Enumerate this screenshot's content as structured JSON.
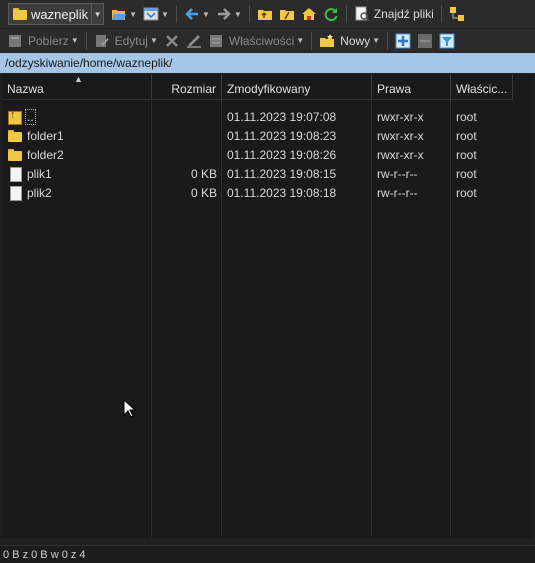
{
  "toolbar": {
    "session_label": "wazneplik",
    "find_files_label": "Znajdź pliki",
    "download_label": "Pobierz",
    "edit_label": "Edytuj",
    "properties_label": "Właściwości",
    "new_label": "Nowy"
  },
  "path": "/odzyskiwanie/home/wazneplik/",
  "columns": {
    "name": "Nazwa",
    "size": "Rozmiar",
    "modified": "Zmodyfikowany",
    "rights": "Prawa",
    "owner": "Właścic..."
  },
  "files": [
    {
      "name": "..",
      "size": "",
      "modified": "01.11.2023 19:07:08",
      "rights": "rwxr-xr-x",
      "owner": "root",
      "icon": "parent-folder-icon"
    },
    {
      "name": "folder1",
      "size": "",
      "modified": "01.11.2023 19:08:23",
      "rights": "rwxr-xr-x",
      "owner": "root",
      "icon": "folder-icon"
    },
    {
      "name": "folder2",
      "size": "",
      "modified": "01.11.2023 19:08:26",
      "rights": "rwxr-xr-x",
      "owner": "root",
      "icon": "folder-icon"
    },
    {
      "name": "plik1",
      "size": "0 KB",
      "modified": "01.11.2023 19:08:15",
      "rights": "rw-r--r--",
      "owner": "root",
      "icon": "file-icon"
    },
    {
      "name": "plik2",
      "size": "0 KB",
      "modified": "01.11.2023 19:08:18",
      "rights": "rw-r--r--",
      "owner": "root",
      "icon": "file-icon"
    }
  ],
  "status": "0 B z 0 B w 0 z 4",
  "colors": {
    "path_bar": "#a5c6e6",
    "folder": "#f2c744",
    "background": "#1a1a1a"
  }
}
